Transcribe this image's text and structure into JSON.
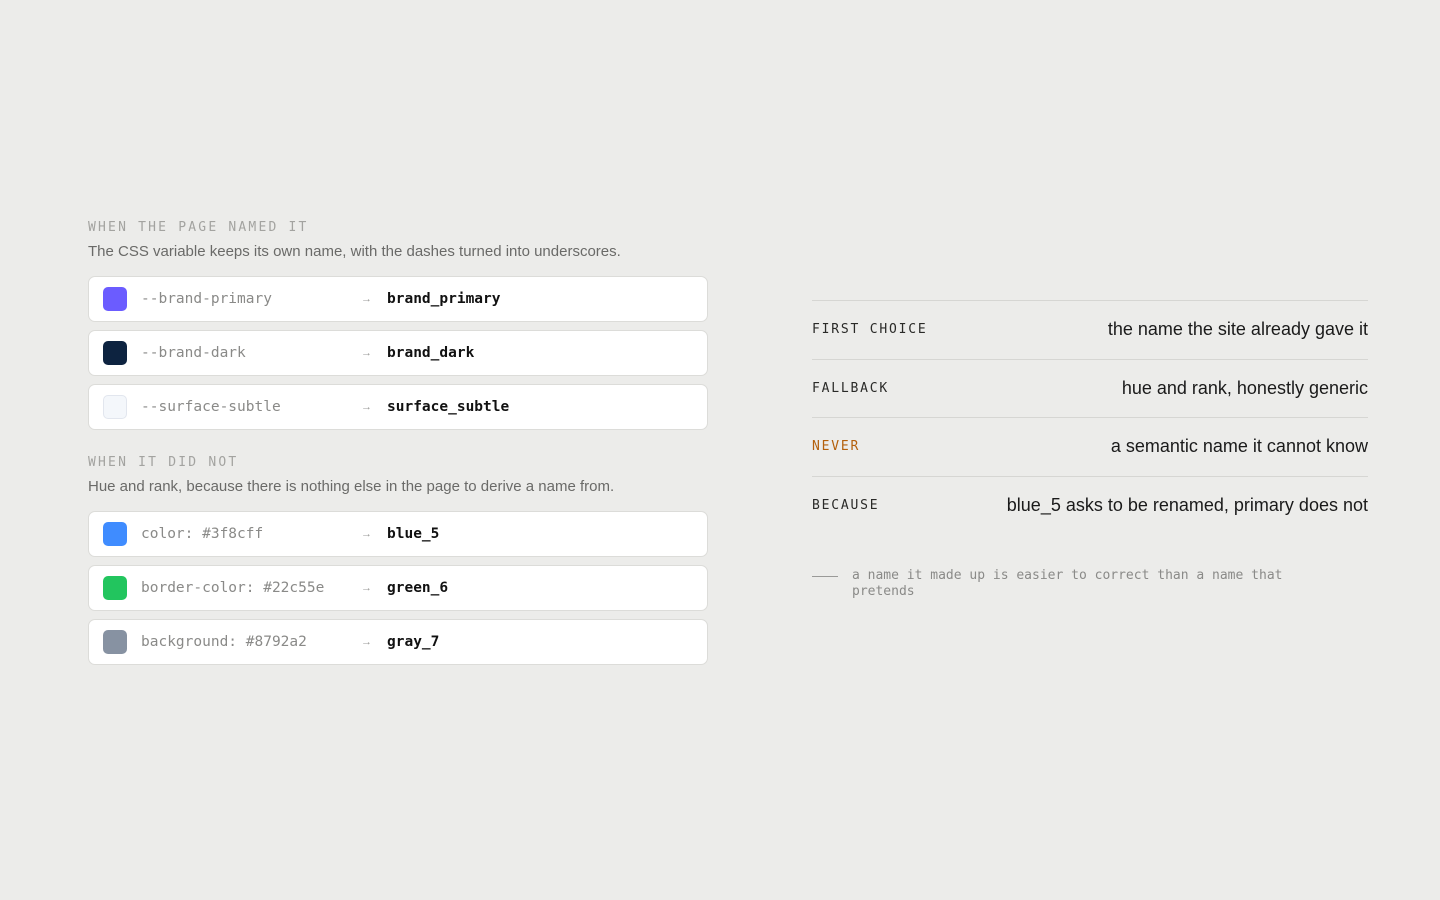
{
  "named": {
    "label": "WHEN THE PAGE NAMED IT",
    "description": "The CSS variable keeps its own name, with the dashes turned into underscores.",
    "rows": [
      {
        "swatch": "#6b5cff",
        "source": "--brand-primary",
        "arrow": "→",
        "target": "brand_primary"
      },
      {
        "swatch": "#0d2340",
        "source": "--brand-dark",
        "arrow": "→",
        "target": "brand_dark"
      },
      {
        "swatch": "#f4f7fb",
        "source": "--surface-subtle",
        "arrow": "→",
        "target": "surface_subtle"
      }
    ]
  },
  "unnamed": {
    "label": "WHEN IT DID NOT",
    "description": "Hue and rank, because there is nothing else in the page to derive a name from.",
    "rows": [
      {
        "swatch": "#3f8cff",
        "source": "color: #3f8cff",
        "arrow": "→",
        "target": "blue_5"
      },
      {
        "swatch": "#22c55e",
        "source": "border-color: #22c55e",
        "arrow": "→",
        "target": "green_6"
      },
      {
        "swatch": "#8792a2",
        "source": "background: #8792a2",
        "arrow": "→",
        "target": "gray_7"
      }
    ]
  },
  "rules": [
    {
      "key": "FIRST CHOICE",
      "value": "the name the site already gave it"
    },
    {
      "key": "FALLBACK",
      "value": "hue and rank, honestly generic"
    },
    {
      "key": "NEVER",
      "value": "a semantic name it cannot know",
      "key_color": "#b4600c"
    },
    {
      "key": "BECAUSE",
      "value": "blue_5 asks to be renamed, primary does not"
    }
  ],
  "note": "a name it made up is easier to correct than a name that pretends"
}
